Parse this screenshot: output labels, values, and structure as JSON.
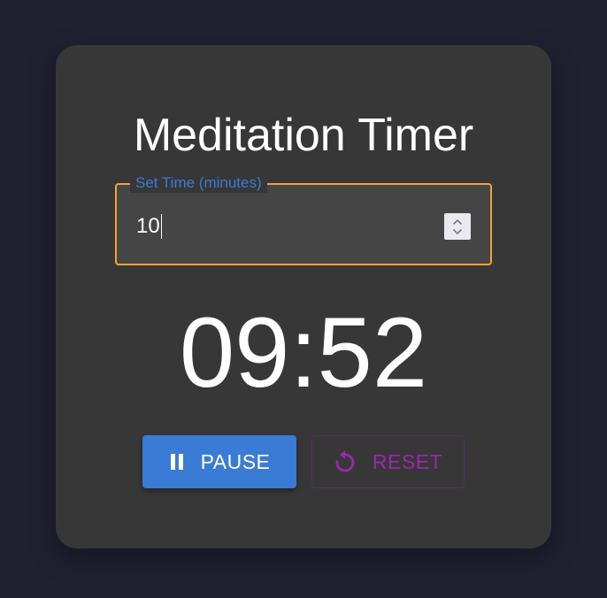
{
  "card": {
    "title": "Meditation Timer"
  },
  "time_field": {
    "label": "Set Time (minutes)",
    "value": "10"
  },
  "timer": {
    "display": "09:52"
  },
  "actions": {
    "pause_label": "PAUSE",
    "pause_icon": "pause-icon",
    "reset_label": "RESET",
    "reset_icon": "replay-icon"
  },
  "colors": {
    "background": "#212031",
    "card": "#373737",
    "primary": "#3a7bd5",
    "secondary": "#9c27b0",
    "field_border_focus": "#f2a33a"
  }
}
